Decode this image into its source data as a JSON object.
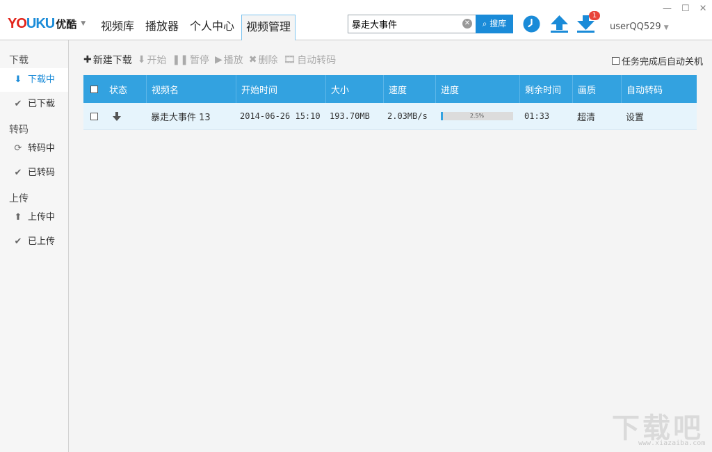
{
  "app": {
    "logo_latin": "YOUKU",
    "logo_cn": "优酷",
    "nav": [
      "视频库",
      "播放器",
      "个人中心",
      "视频管理"
    ],
    "active_nav": "视频管理"
  },
  "search": {
    "value": "暴走大事件",
    "button_label": "搜库"
  },
  "header": {
    "download_badge": "1",
    "username": "userQQ529",
    "accent_color": "#1a8bd8"
  },
  "sidebar": {
    "sections": [
      {
        "title": "下载",
        "items": [
          {
            "label": "下载中",
            "icon": "download-arrow-icon",
            "active": true
          },
          {
            "label": "已下载",
            "icon": "check-icon"
          }
        ]
      },
      {
        "title": "转码",
        "items": [
          {
            "label": "转码中",
            "icon": "refresh-icon"
          },
          {
            "label": "已转码",
            "icon": "check-icon"
          }
        ]
      },
      {
        "title": "上传",
        "items": [
          {
            "label": "上传中",
            "icon": "upload-arrow-icon"
          },
          {
            "label": "已上传",
            "icon": "check-icon"
          }
        ]
      }
    ]
  },
  "toolbar": {
    "new_download": "新建下载",
    "start": "开始",
    "pause": "暂停",
    "play": "播放",
    "delete": "删除",
    "auto_transcode": "自动转码"
  },
  "auto_shutdown_label": "任务完成后自动关机",
  "table": {
    "headers": [
      "状态",
      "视频名",
      "开始时间",
      "大小",
      "速度",
      "进度",
      "剩余时间",
      "画质",
      "自动转码"
    ],
    "rows": [
      {
        "status_icon": "download-arrow-icon",
        "name": "暴走大事件 13",
        "start_time": "2014-06-26 15:10",
        "size": "193.70MB",
        "speed": "2.03MB/s",
        "progress": "2.5%",
        "progress_value": 0.025,
        "remaining": "01:33",
        "quality": "超清",
        "auto_transcode": "设置"
      }
    ]
  },
  "watermark": {
    "text": "下载吧",
    "url": "www.xiazaiba.com"
  }
}
